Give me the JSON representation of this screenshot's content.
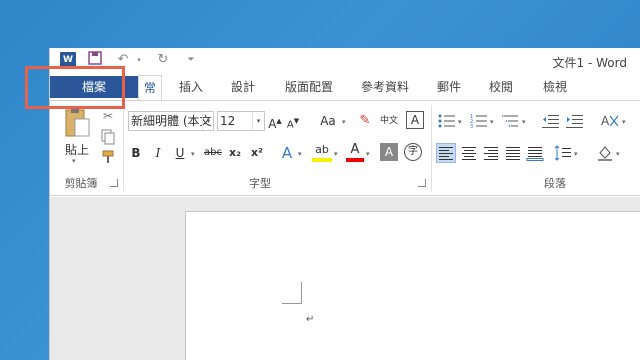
{
  "window": {
    "title": "文件1 - Word"
  },
  "qat": {
    "word_logo": "W"
  },
  "tabs": {
    "file": "檔案",
    "home": "常用",
    "others": [
      "插入",
      "設計",
      "版面配置",
      "參考資料",
      "郵件",
      "校閱",
      "檢視"
    ]
  },
  "clipboard": {
    "paste_label": "貼上",
    "group_label": "剪貼簿"
  },
  "font": {
    "name": "新細明體 (本文",
    "size": "12",
    "group_label": "字型",
    "aa_grow": "A",
    "aa_shrink": "A",
    "case": "Aa",
    "bold": "B",
    "italic": "I",
    "underline": "U",
    "strike": "abc",
    "sub": "x₂",
    "sup": "x²",
    "effects": "A",
    "highlight": "ab",
    "color": "A",
    "shade": "A",
    "enclose": "字",
    "phonetic": "中文",
    "border": "A"
  },
  "paragraph": {
    "group_label": "段落"
  },
  "colors": {
    "accent": "#2b579a",
    "highlight_box": "#e8614b",
    "desktop": "#2f86c9"
  }
}
